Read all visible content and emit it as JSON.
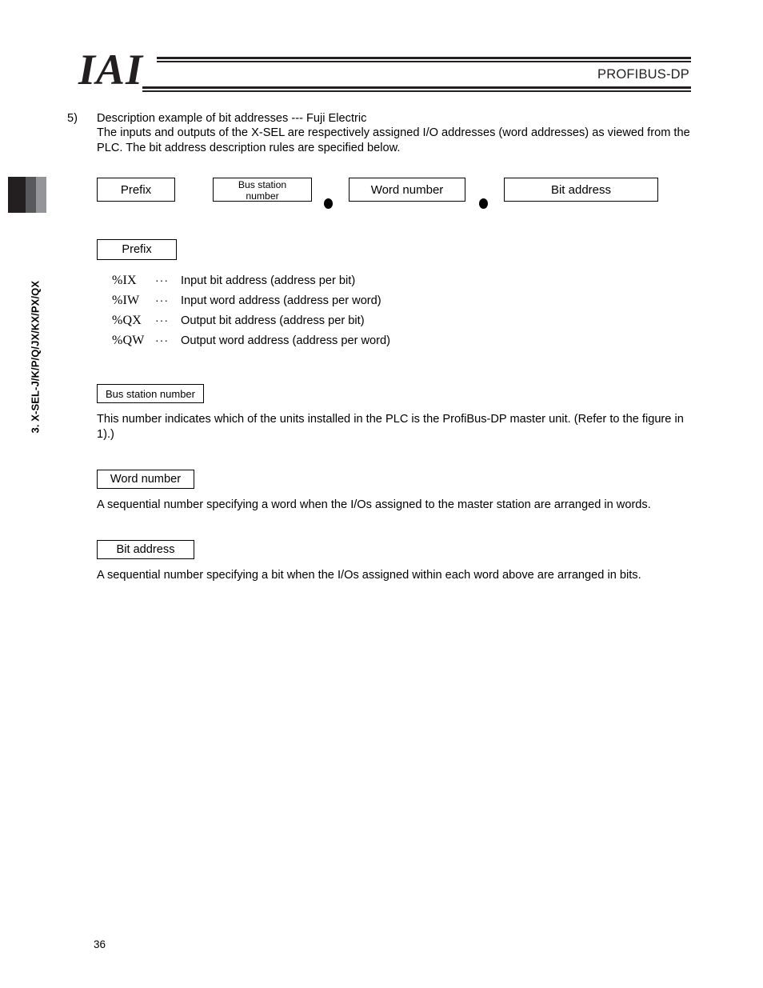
{
  "header": {
    "logo": "IAI",
    "title": "PROFIBUS-DP"
  },
  "side_tab": {
    "label": "3. X-SEL-J/K/P/Q/JX/KX/PX/QX",
    "colors": [
      "#231f20",
      "#58595b",
      "#939598"
    ]
  },
  "section": {
    "number": "5)",
    "title": "Description example of bit addresses --- Fuji Electric",
    "intro": "The inputs and outputs of the X-SEL are respectively assigned I/O addresses (word addresses) as viewed from the PLC. The bit address description rules are specified below."
  },
  "diagram": {
    "boxes": [
      {
        "label": "Prefix"
      },
      {
        "label": "Bus station\nnumber"
      },
      {
        "label": "Word number"
      },
      {
        "label": "Bit address"
      }
    ],
    "separator": "●"
  },
  "prefix_section": {
    "heading": "Prefix",
    "rows": [
      {
        "code": "%IX",
        "dots": "···",
        "description": "Input bit address (address per bit)"
      },
      {
        "code": "%IW",
        "dots": "···",
        "description": "Input word address (address per word)"
      },
      {
        "code": "%QX",
        "dots": "···",
        "description": "Output bit address (address per bit)"
      },
      {
        "code": "%QW",
        "dots": "···",
        "description": "Output word address (address per word)"
      }
    ]
  },
  "bus_station_section": {
    "heading": "Bus station number",
    "text": "This number indicates which of the units installed in the PLC is the ProfiBus-DP master unit. (Refer to the figure in 1).)"
  },
  "word_number_section": {
    "heading": "Word number",
    "text": "A sequential number specifying a word when the I/Os assigned to the master station are arranged in words."
  },
  "bit_address_section": {
    "heading": "Bit address",
    "text": "A sequential number specifying a bit when the I/Os assigned within each word above are arranged in bits."
  },
  "footer": {
    "page_number": "36"
  }
}
